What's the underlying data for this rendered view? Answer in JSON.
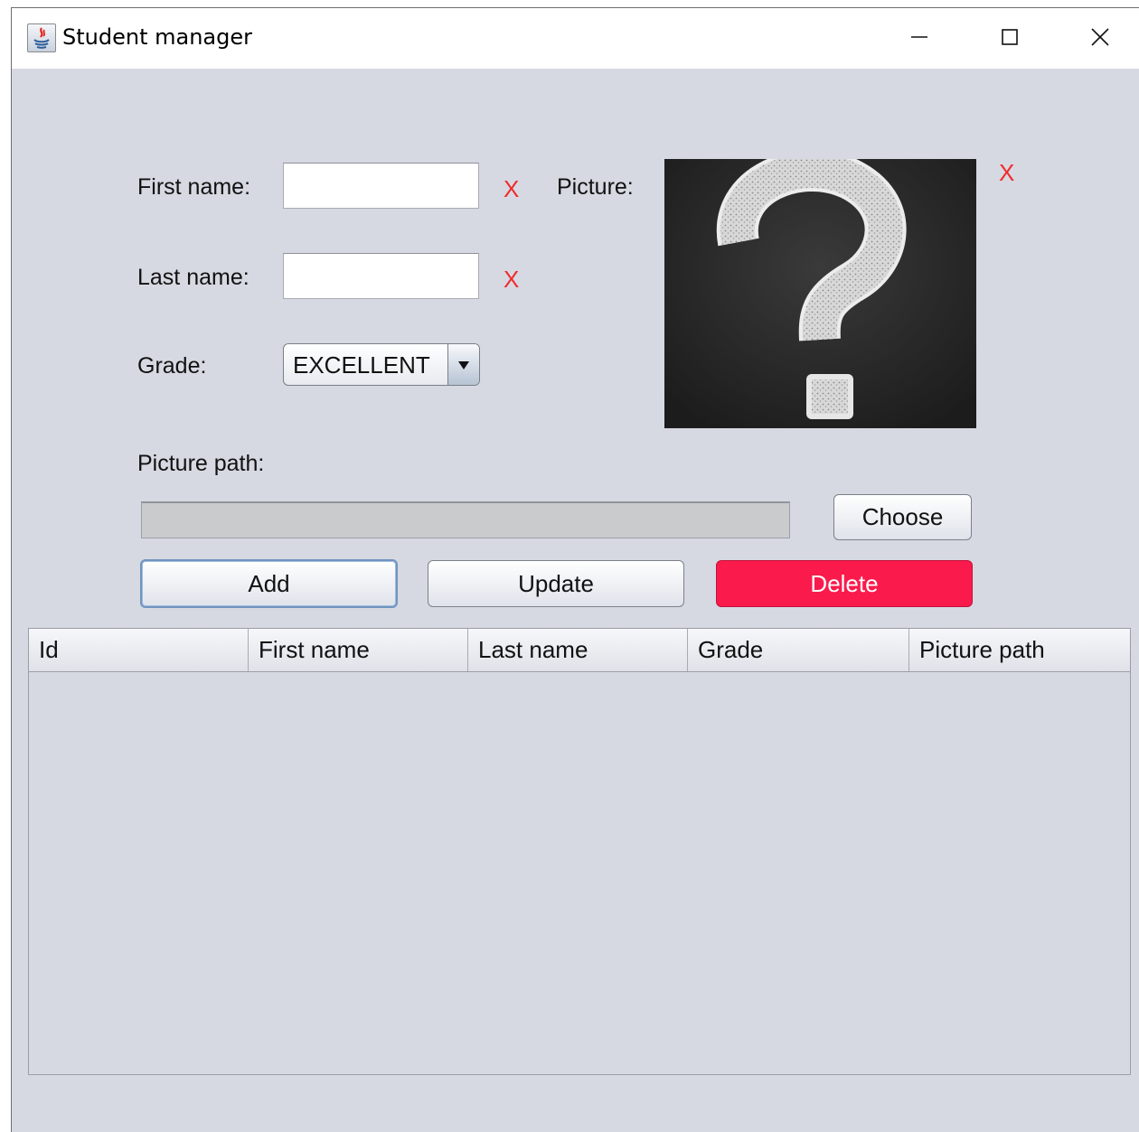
{
  "window": {
    "title": "Student manager",
    "controls": {
      "minimize": "minimize",
      "maximize": "maximize",
      "close": "close"
    }
  },
  "form": {
    "first_name": {
      "label": "First name:",
      "value": "",
      "error_mark": "X"
    },
    "last_name": {
      "label": "Last name:",
      "value": "",
      "error_mark": "X"
    },
    "grade": {
      "label": "Grade:",
      "selected": "EXCELLENT"
    },
    "picture": {
      "label": "Picture:",
      "error_mark": "X",
      "image": "question-mark-chalkboard"
    },
    "picture_path": {
      "label": "Picture path:",
      "value": ""
    },
    "choose_label": "Choose"
  },
  "actions": {
    "add": "Add",
    "update": "Update",
    "delete": "Delete"
  },
  "colors": {
    "delete_button": "#fa1a4c",
    "error_mark": "#f02b2b",
    "window_bg": "#d6d9e2"
  },
  "table": {
    "columns": [
      "Id",
      "First name",
      "Last name",
      "Grade",
      "Picture path"
    ],
    "rows": []
  }
}
